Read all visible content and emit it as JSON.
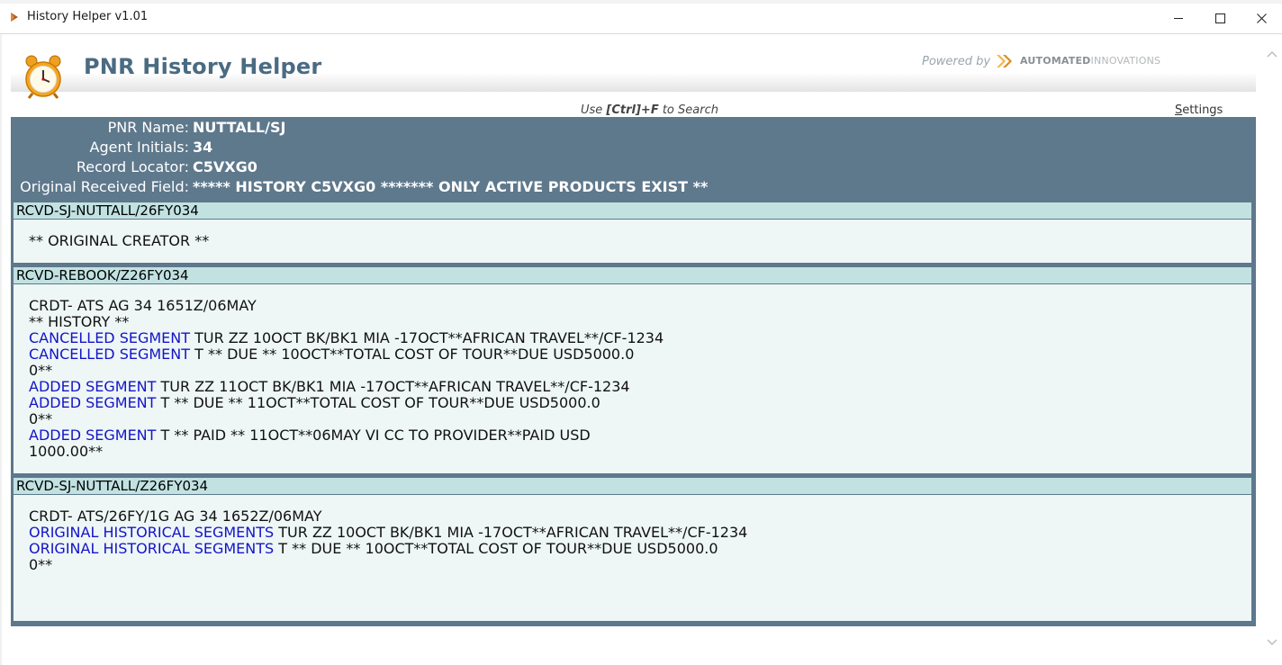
{
  "window": {
    "title": "History Helper v1.01"
  },
  "header": {
    "app_title": "PNR History Helper",
    "powered_by": "Powered by",
    "brand_bold": "AUTOMATED",
    "brand_light": "INNOVATIONS",
    "search_hint_prefix": "Use ",
    "search_hint_key": "[Ctrl]+F",
    "search_hint_suffix": " to Search",
    "settings_first": "S",
    "settings_rest": "ettings"
  },
  "pnr": {
    "name_label": "PNR Name:",
    "name_value": "NUTTALL/SJ",
    "agent_label": "Agent Initials:",
    "agent_value": "34",
    "locator_label": "Record Locator:",
    "locator_value": "C5VXG0",
    "received_label": "Original Received Field:",
    "received_value": "***** HISTORY C5VXG0 ******* ONLY ACTIVE PRODUCTS EXIST **"
  },
  "sections": [
    {
      "header": "RCVD-SJ-NUTTALL/26FY034",
      "lines": [
        {
          "kw": "",
          "text": "** ORIGINAL CREATOR **"
        }
      ]
    },
    {
      "header": "RCVD-REBOOK/Z26FY034",
      "lines": [
        {
          "kw": "",
          "text": "CRDT- ATS AG 34 1651Z/06MAY"
        },
        {
          "kw": "",
          "text": "** HISTORY **"
        },
        {
          "kw": "CANCELLED SEGMENT",
          "text": " TUR ZZ 10OCT BK/BK1 MIA -17OCT**AFRICAN TRAVEL**/CF-1234"
        },
        {
          "kw": "CANCELLED SEGMENT",
          "text": " T ** DUE ** 10OCT**TOTAL COST OF TOUR**DUE USD5000.0"
        },
        {
          "kw": "",
          "text": "0**"
        },
        {
          "kw": "ADDED SEGMENT",
          "text": " TUR ZZ 11OCT BK/BK1 MIA -17OCT**AFRICAN TRAVEL**/CF-1234"
        },
        {
          "kw": "ADDED SEGMENT",
          "text": " T ** DUE ** 11OCT**TOTAL COST OF TOUR**DUE USD5000.0"
        },
        {
          "kw": "",
          "text": "0**"
        },
        {
          "kw": "ADDED SEGMENT",
          "text": " T ** PAID ** 11OCT**06MAY VI CC TO PROVIDER**PAID USD"
        },
        {
          "kw": "",
          "text": "1000.00**"
        }
      ]
    },
    {
      "header": "RCVD-SJ-NUTTALL/Z26FY034",
      "lines": [
        {
          "kw": "",
          "text": "CRDT- ATS/26FY/1G AG 34 1652Z/06MAY"
        },
        {
          "kw": "ORIGINAL HISTORICAL SEGMENTS",
          "text": " TUR ZZ 10OCT BK/BK1 MIA -17OCT**AFRICAN TRAVEL**/CF-1234"
        },
        {
          "kw": "ORIGINAL HISTORICAL SEGMENTS",
          "text": " T ** DUE ** 10OCT**TOTAL COST OF TOUR**DUE USD5000.0"
        },
        {
          "kw": "",
          "text": "0**"
        }
      ]
    }
  ]
}
